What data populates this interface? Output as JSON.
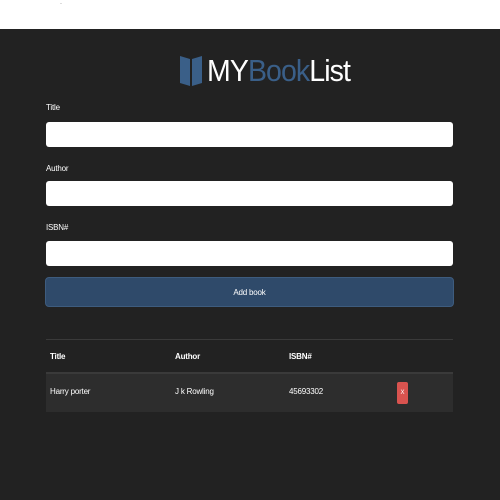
{
  "topbar": {
    "mark": "·"
  },
  "brand": {
    "my": "MY",
    "book": "Book",
    "list": "List",
    "icon": "book-icon"
  },
  "form": {
    "title_label": "Title",
    "title_value": "",
    "author_label": "Author",
    "author_value": "",
    "isbn_label": "ISBN#",
    "isbn_value": "",
    "submit_label": "Add book"
  },
  "table": {
    "headers": [
      "Title",
      "Author",
      "ISBN#",
      ""
    ],
    "rows": [
      {
        "title": "Harry porter",
        "author": "J k Rowling",
        "isbn": "45693302",
        "delete_label": "X"
      }
    ]
  },
  "colors": {
    "background": "#222222",
    "accent": "#2f4a6a",
    "brand_book": "#3a5f88",
    "delete": "#d9534f"
  }
}
